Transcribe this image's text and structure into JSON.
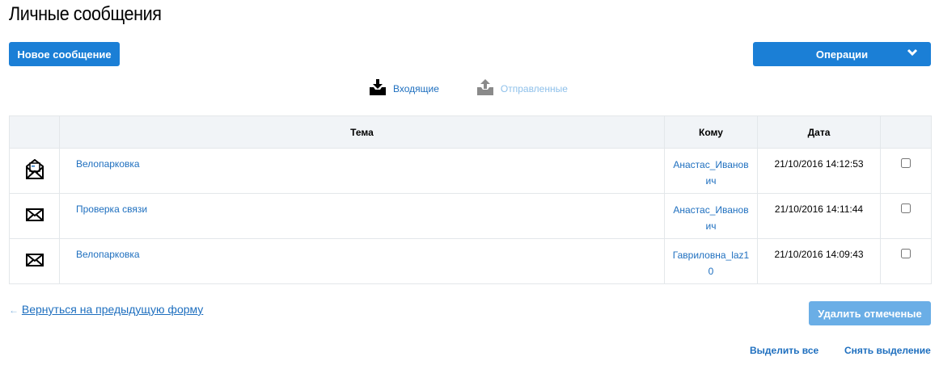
{
  "title": "Личные сообщения",
  "new_message": "Новое сообщение",
  "operations": "Операции",
  "tabs": {
    "inbox": "Входящие",
    "sent": "Отправленные"
  },
  "columns": {
    "subject": "Тема",
    "to": "Кому",
    "date": "Дата"
  },
  "rows": [
    {
      "icon": "open-envelope-icon",
      "subject": "Велопарковка",
      "to": "Анастас_Иванович",
      "date": "21/10/2016 14:12:53"
    },
    {
      "icon": "envelope-icon",
      "subject": "Проверка связи",
      "to": "Анастас_Иванович",
      "date": "21/10/2016 14:11:44"
    },
    {
      "icon": "envelope-icon",
      "subject": "Велопарковка",
      "to": "Гавриловна_laz10",
      "date": "21/10/2016 14:09:43"
    }
  ],
  "back_link": "Вернуться на предыдущую форму",
  "delete_marked": "Удалить отмеченые",
  "select_all": "Выделить все",
  "deselect": "Снять выделение",
  "colors": {
    "primary": "#1b7fd6",
    "disabled": "#6aaee6",
    "link": "#1e6fbf"
  }
}
